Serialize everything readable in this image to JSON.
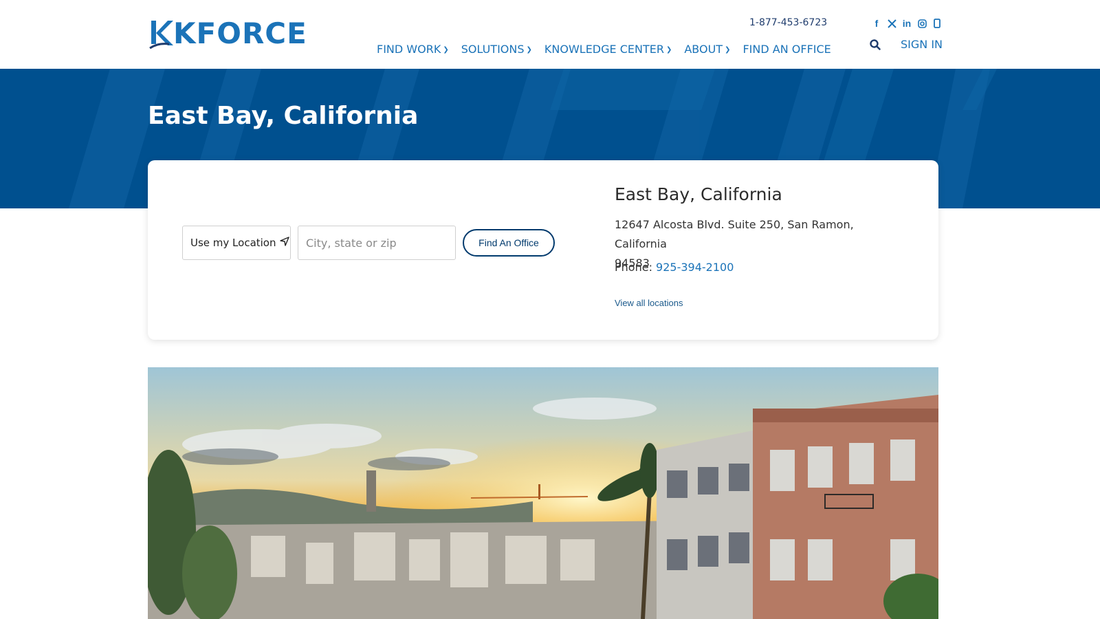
{
  "header": {
    "logo_text": "KFORCE",
    "phone": "1-877-453-6723",
    "social": [
      "facebook-icon",
      "x-twitter-icon",
      "linkedin-icon",
      "instagram-icon",
      "mobile-icon"
    ],
    "nav": [
      {
        "label": "FIND WORK",
        "has_dropdown": true
      },
      {
        "label": "SOLUTIONS",
        "has_dropdown": true
      },
      {
        "label": "KNOWLEDGE CENTER",
        "has_dropdown": true
      },
      {
        "label": "ABOUT",
        "has_dropdown": true
      },
      {
        "label": "FIND AN OFFICE",
        "has_dropdown": false
      }
    ],
    "sign_in": "SIGN IN"
  },
  "hero": {
    "title": "East Bay, California"
  },
  "search": {
    "use_location": "Use my Location",
    "city_placeholder": "City, state or zip",
    "find_button": "Find An Office"
  },
  "office": {
    "name": "East Bay, California",
    "address_line1": "12647 Alcosta Blvd. Suite 250, San Ramon, California",
    "address_line2": "94583",
    "phone_label": "Phone:",
    "phone": "925-394-2100",
    "view_all": "View all locations"
  },
  "colors": {
    "brand_blue": "#1b73b8",
    "hero_blue": "#00508f",
    "dark_navy": "#003a6d"
  }
}
